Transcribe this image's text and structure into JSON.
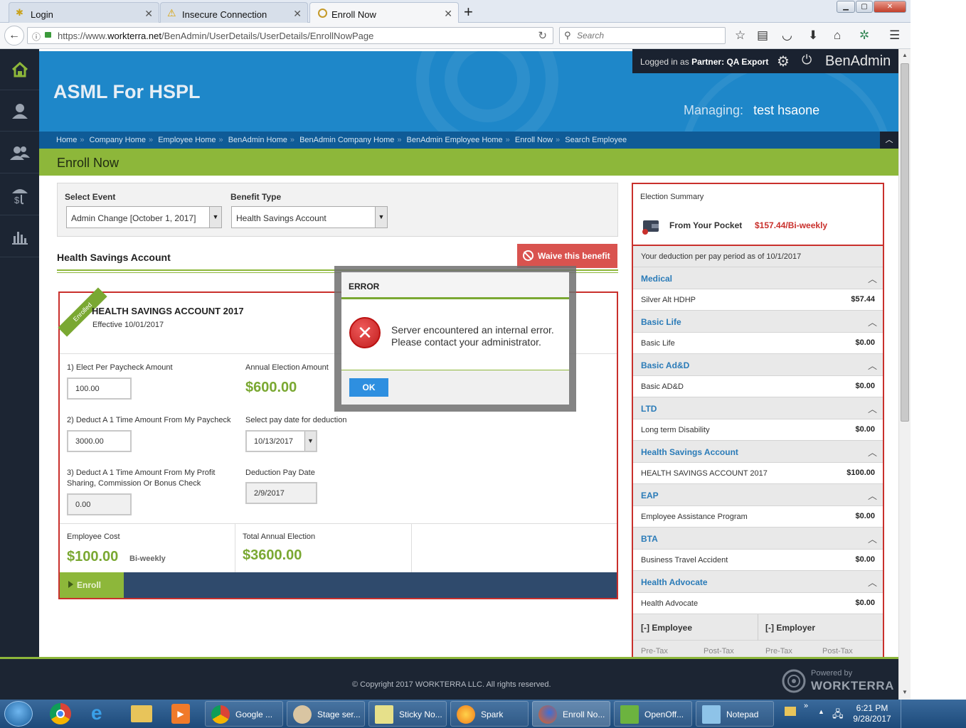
{
  "browser": {
    "tabs": [
      {
        "label": "Login"
      },
      {
        "label": "Insecure Connection"
      },
      {
        "label": "Enroll Now"
      }
    ],
    "url_prefix": "https://www.",
    "url_domain": "workterra.net",
    "url_path": "/BenAdmin/UserDetails/UserDetails/EnrollNowPage",
    "search_placeholder": "Search"
  },
  "header": {
    "company": "ASML For HSPL",
    "logged_in_prefix": "Logged in as",
    "logged_in_role": "Partner:",
    "logged_in_user": "QA Export",
    "brand": "BenAdmin",
    "managing_label": "Managing:",
    "managing_name": "test hsaone"
  },
  "breadcrumb": [
    "Home",
    "Company Home",
    "Employee Home",
    "BenAdmin Home",
    "BenAdmin Company Home",
    "BenAdmin Employee Home",
    "Enroll Now",
    "Search Employee"
  ],
  "page_title": "Enroll Now",
  "selectors": {
    "event_label": "Select Event",
    "event_value": "Admin Change [October 1, 2017]",
    "benefit_label": "Benefit Type",
    "benefit_value": "Health Savings Account"
  },
  "section_title": "Health Savings Account",
  "waive_label": "Waive this benefit",
  "plan": {
    "ribbon": "Enrolled",
    "title": "HEALTH SAVINGS ACCOUNT 2017",
    "effective": "Effective 10/01/2017",
    "elect_label": "1) Elect Per Paycheck Amount",
    "elect_value": "100.00",
    "annual_label": "Annual Election Amount",
    "annual_value": "$600.00",
    "deduct_once_label": "2) Deduct A 1 Time Amount From My Paycheck",
    "deduct_once_value": "3000.00",
    "pay_date_label": "Select pay date for deduction",
    "pay_date_value": "10/13/2017",
    "profit_label_1": "3) Deduct A 1 Time Amount From My Profit",
    "profit_label_2": "Sharing, Commission Or Bonus Check",
    "profit_value": "0.00",
    "deduction_date_label": "Deduction Pay Date",
    "deduction_date_value": "2/9/2017",
    "employee_cost_label": "Employee Cost",
    "employee_cost_value": "$100.00",
    "employee_cost_freq": "Bi-weekly",
    "total_annual_label": "Total Annual Election",
    "total_annual_value": "$3600.00",
    "enroll_label": "Enroll"
  },
  "summary": {
    "title": "Election Summary",
    "pocket_label": "From Your Pocket",
    "pocket_value": "$157.44/Bi-weekly",
    "asof": "Your deduction per pay period as of 10/1/2017",
    "groups": [
      {
        "head": "Medical",
        "item": "Silver Alt HDHP",
        "value": "$57.44"
      },
      {
        "head": "Basic Life",
        "item": "Basic Life",
        "value": "$0.00"
      },
      {
        "head": "Basic Ad&D",
        "item": "Basic AD&D",
        "value": "$0.00"
      },
      {
        "head": "LTD",
        "item": "Long term Disability",
        "value": "$0.00"
      },
      {
        "head": "Health Savings Account",
        "item": "HEALTH SAVINGS ACCOUNT 2017",
        "value": "$100.00"
      },
      {
        "head": "EAP",
        "item": "Employee Assistance Program",
        "value": "$0.00"
      },
      {
        "head": "BTA",
        "item": "Business Travel Accident",
        "value": "$0.00"
      },
      {
        "head": "Health Advocate",
        "item": "Health Advocate",
        "value": "$0.00"
      }
    ],
    "employee_head": "[-] Employee",
    "employer_head": "[-] Employer",
    "pretax": "Pre-Tax",
    "posttax": "Post-Tax"
  },
  "footer": {
    "copyright": "© Copyright 2017 WORKTERRA LLC. All rights reserved.",
    "powered_by": "Powered by",
    "brand": "WORKTERRA"
  },
  "modal": {
    "title": "ERROR",
    "message_1": "Server encountered an internal error.",
    "message_2": "Please contact your administrator.",
    "ok": "OK"
  },
  "taskbar": {
    "items": [
      "Google ...",
      "Stage ser...",
      "Sticky No...",
      "Spark",
      "Enroll No...",
      "OpenOff...",
      "Notepad"
    ],
    "time": "6:21 PM",
    "date": "9/28/2017"
  },
  "colors": {
    "accent_green": "#8db73a",
    "header_blue": "#1e87c9",
    "error_red": "#c9302c",
    "sidebar_dark": "#1c2533"
  }
}
